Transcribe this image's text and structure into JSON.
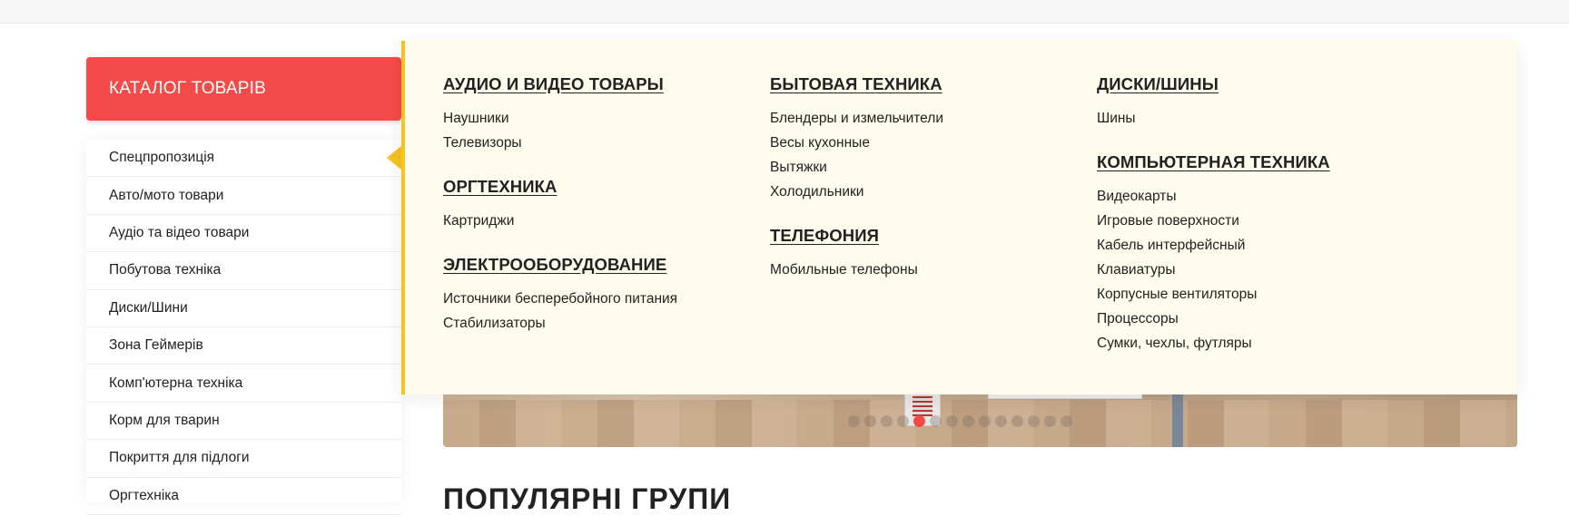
{
  "catalog": {
    "button_label": "КАТАЛОГ ТОВАРІВ"
  },
  "sidebar": {
    "items": [
      {
        "label": "Спецпропозиція"
      },
      {
        "label": "Авто/мото товари"
      },
      {
        "label": "Аудіо та відео товари"
      },
      {
        "label": "Побутова техніка"
      },
      {
        "label": "Диски/Шини"
      },
      {
        "label": "Зона Геймерів"
      },
      {
        "label": "Комп'ютерна техніка"
      },
      {
        "label": "Корм для тварин"
      },
      {
        "label": "Покриття для підлоги"
      },
      {
        "label": "Оргтехніка"
      }
    ]
  },
  "mega_menu": {
    "columns": [
      {
        "groups": [
          {
            "title": "АУДИО И ВИДЕО ТОВАРЫ",
            "links": [
              "Наушники",
              "Телевизоры"
            ]
          },
          {
            "title": "ОРГТЕХНИКА",
            "links": [
              "Картриджи"
            ]
          },
          {
            "title": "ЭЛЕКТРООБОРУДОВАНИЕ",
            "links": [
              "Источники бесперебойного питания",
              "Стабилизаторы"
            ]
          }
        ]
      },
      {
        "groups": [
          {
            "title": "БЫТОВАЯ ТЕХНИКА",
            "links": [
              "Блендеры и измельчители",
              "Весы кухонные",
              "Вытяжки",
              "Холодильники"
            ]
          },
          {
            "title": "ТЕЛЕФОНИЯ",
            "links": [
              "Мобильные телефоны"
            ]
          }
        ]
      },
      {
        "groups": [
          {
            "title": "ДИСКИ/ШИНЫ",
            "links": [
              "Шины"
            ]
          },
          {
            "title": "КОМПЬЮТЕРНАЯ ТЕХНИКА",
            "links": [
              "Видеокарты",
              "Игровые поверхности",
              "Кабель интерфейсный",
              "Клавиатуры",
              "Корпусные вентиляторы",
              "Процессоры",
              "Сумки, чехлы, футляры"
            ]
          }
        ]
      }
    ]
  },
  "slider": {
    "dot_count": 14,
    "active_index": 4
  },
  "popular": {
    "title": "ПОПУЛЯРНІ ГРУПИ"
  },
  "colors": {
    "accent_red": "#f54a4a",
    "accent_yellow": "#f6c323",
    "menu_bg": "#fffced"
  }
}
